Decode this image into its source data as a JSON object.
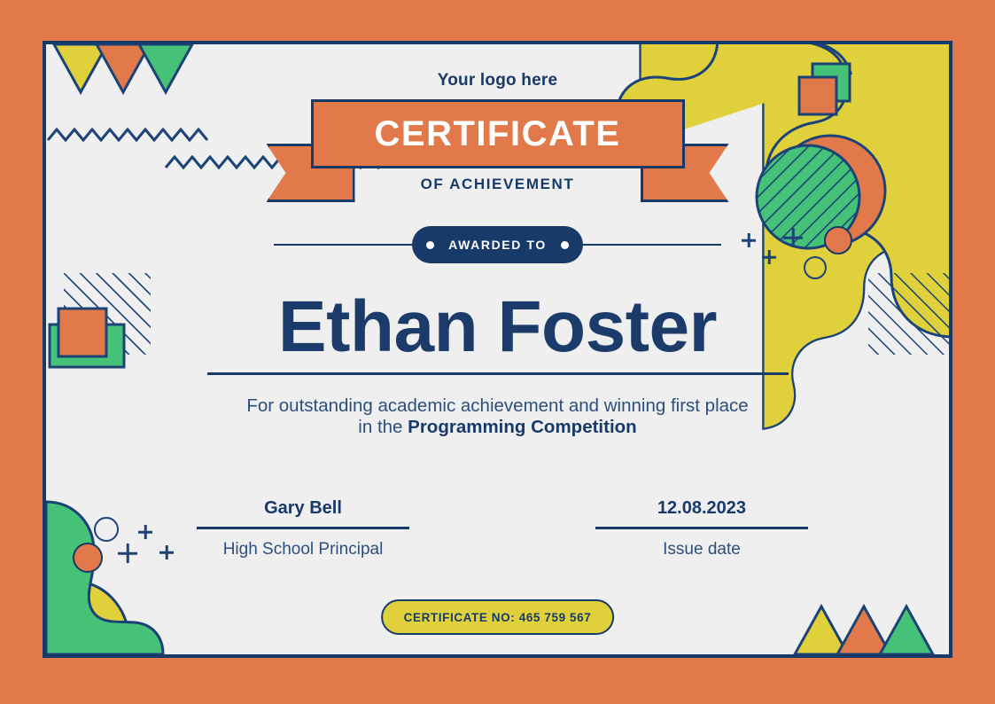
{
  "document": {
    "type": "certificate",
    "logo_placeholder": "Your logo here",
    "title": "CERTIFICATE",
    "subtitle": "OF ACHIEVEMENT",
    "awarded_to_label": "AWARDED TO",
    "recipient_name": "Ethan Foster",
    "description_line1": "For outstanding academic achievement and winning first place",
    "description_line2_prefix": "in the ",
    "description_line2_bold": "Programming Competition",
    "certificate_number_label": "CERTIFICATE NO: 465 759 567"
  },
  "signatures": [
    {
      "value": "Gary Bell",
      "caption": "High School Principal"
    },
    {
      "value": "12.08.2023",
      "caption": "Issue date"
    }
  ],
  "colors": {
    "border_orange": "#E2794A",
    "navy": "#183A68",
    "navy_text": "#1B3C6B",
    "body_text": "#2D4F7C",
    "background": "#EFEFEF",
    "yellow": "#E0D13C",
    "green": "#46C278",
    "white": "#FFFFFF"
  },
  "decorations": {
    "top_left_triangles": [
      "yellow",
      "orange",
      "green"
    ],
    "bottom_right_triangles": [
      "yellow",
      "orange",
      "green"
    ],
    "zigzag_count": 2,
    "plus_marks": 6,
    "hatched_circle": "green",
    "hatched_squares": 2,
    "blobs": [
      "yellow",
      "green"
    ]
  }
}
